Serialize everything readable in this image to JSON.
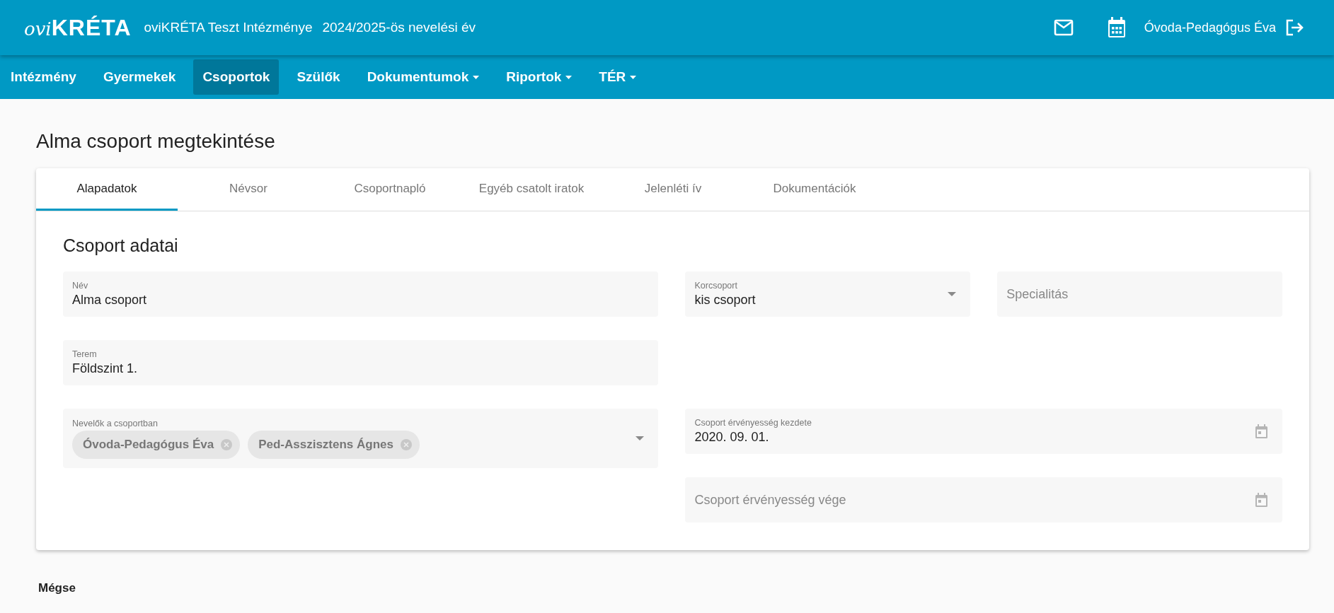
{
  "header": {
    "logo": {
      "script": "ovi",
      "word": "KRÉTA"
    },
    "institution": "oviKRÉTA Teszt Intézménye",
    "year": "2024/2025-ös nevelési év",
    "user": "Óvoda-Pedagógus Éva"
  },
  "nav": [
    {
      "label": "Intézmény",
      "selected": false,
      "dropdown": false
    },
    {
      "label": "Gyermekek",
      "selected": false,
      "dropdown": false
    },
    {
      "label": "Csoportok",
      "selected": true,
      "dropdown": false
    },
    {
      "label": "Szülők",
      "selected": false,
      "dropdown": false
    },
    {
      "label": "Dokumentumok",
      "selected": false,
      "dropdown": true
    },
    {
      "label": "Riportok",
      "selected": false,
      "dropdown": true
    },
    {
      "label": "TÉR",
      "selected": false,
      "dropdown": true
    }
  ],
  "page_title": "Alma csoport megtekintése",
  "tabs": [
    {
      "label": "Alapadatok",
      "selected": true
    },
    {
      "label": "Névsor",
      "selected": false
    },
    {
      "label": "Csoportnapló",
      "selected": false
    },
    {
      "label": "Egyéb csatolt iratok",
      "selected": false
    },
    {
      "label": "Jelenléti ív",
      "selected": false
    },
    {
      "label": "Dokumentációk",
      "selected": false
    }
  ],
  "section_title": "Csoport adatai",
  "fields": [
    {
      "kind": "text",
      "label": "Név",
      "value": "Alma csoport"
    },
    {
      "kind": "select",
      "label": "Korcsoport",
      "value": "kis csoport"
    },
    {
      "kind": "text",
      "placeholder": "Specialitás"
    },
    {
      "kind": "text",
      "label": "Terem",
      "value": "Földszint 1."
    },
    {
      "kind": "chips",
      "label": "Nevelők a csoportban",
      "chips": [
        "Óvoda-Pedagógus Éva",
        "Ped-Asszisztens Ágnes"
      ]
    },
    {
      "kind": "date",
      "label": "Csoport érvényesség kezdete",
      "value": "2020. 09. 01."
    },
    {
      "kind": "date",
      "placeholder": "Csoport érvényesség vége"
    }
  ],
  "cancel_button": "Mégse"
}
